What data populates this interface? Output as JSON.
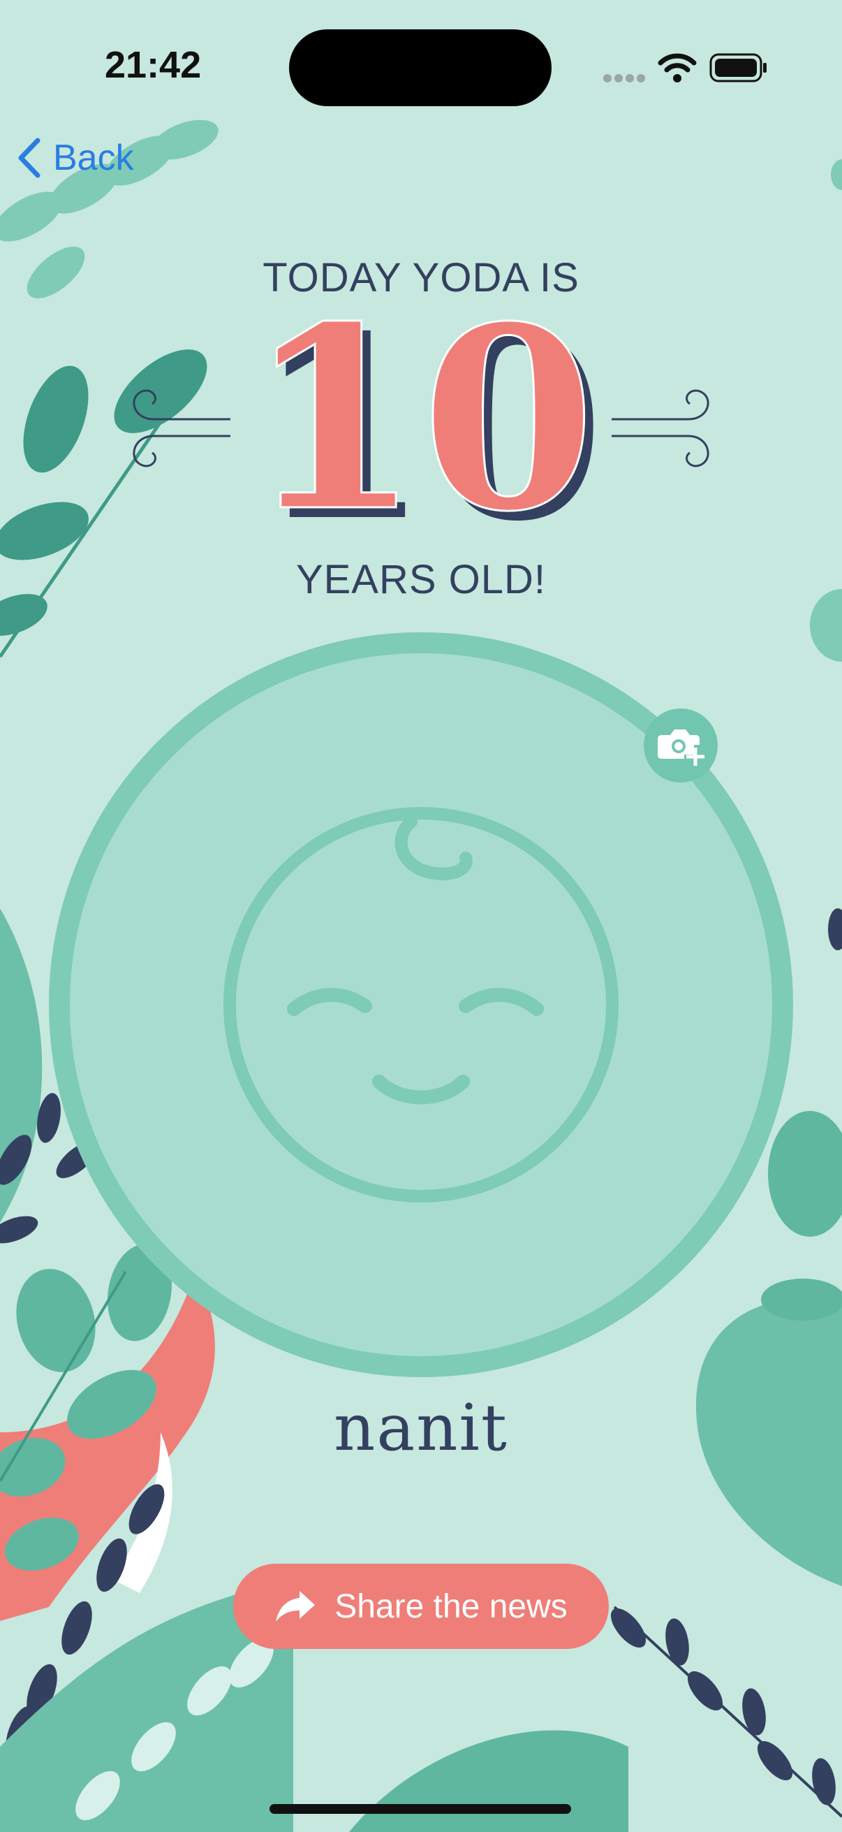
{
  "status_bar": {
    "time": "21:42"
  },
  "nav": {
    "back_label": "Back"
  },
  "headline": {
    "line1": "TODAY YODA IS",
    "age_number": "10",
    "line2": "YEARS OLD!"
  },
  "brand": {
    "name": "nanit"
  },
  "actions": {
    "share_label": "Share the news"
  },
  "colors": {
    "background": "#c6e8de",
    "accent_red": "#ef7e79",
    "navy": "#34405f",
    "ios_blue": "#2a7de1",
    "circle_fill": "#a9dcd0",
    "circle_ring": "#7ecbb6"
  },
  "icons": [
    "back-chevron-icon",
    "camera-plus-icon",
    "share-arrow-icon",
    "wifi-icon",
    "battery-icon",
    "signal-icon",
    "baby-face-icon"
  ]
}
